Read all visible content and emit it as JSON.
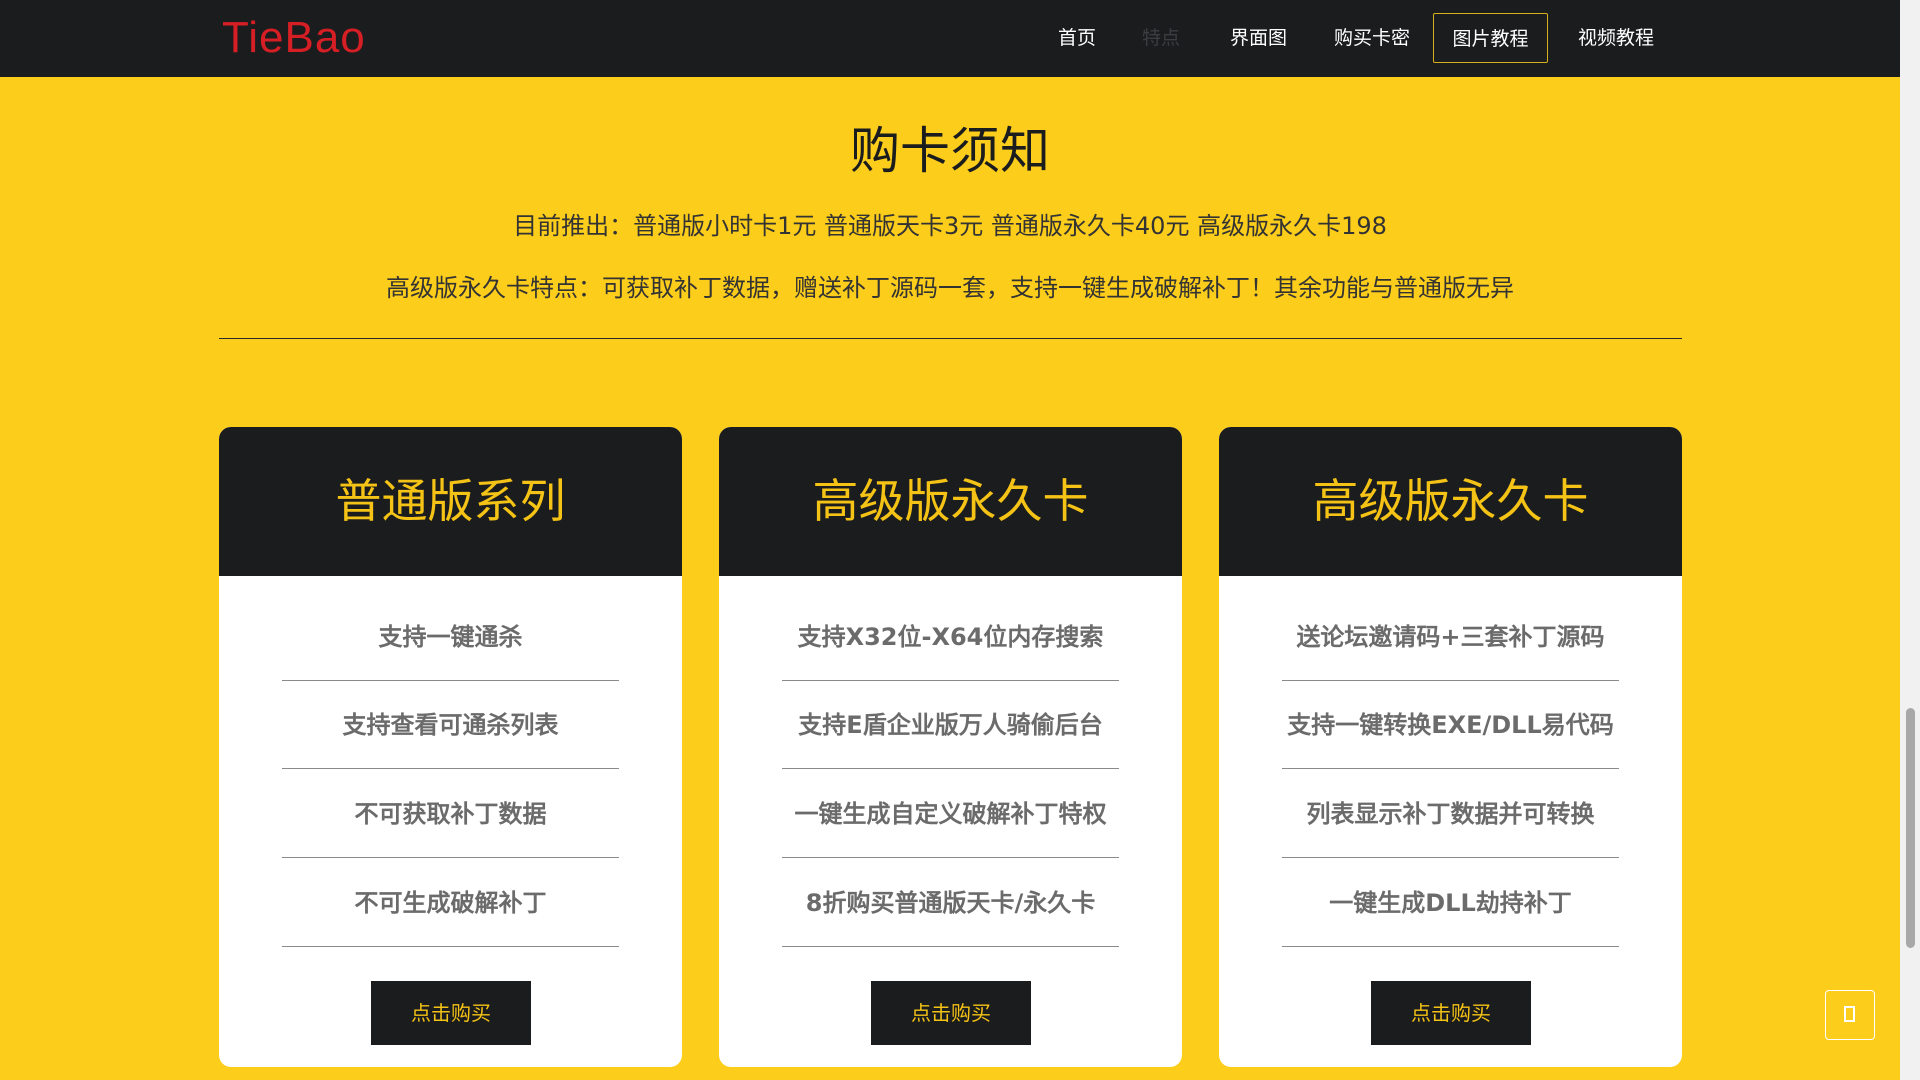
{
  "nav": {
    "logo": "TieBao",
    "items": [
      {
        "label": "首页"
      },
      {
        "label": "特点"
      },
      {
        "label": "界面图"
      },
      {
        "label": "购买卡密"
      },
      {
        "label": "图片教程"
      },
      {
        "label": "视频教程"
      }
    ],
    "active_item": "图片教程"
  },
  "notice": {
    "title": "购卡须知",
    "line1": "目前推出：普通版小时卡1元 普通版天卡3元 普通版永久卡40元 高级版永久卡198",
    "line2": "高级版永久卡特点：可获取补丁数据，赠送补丁源码一套，支持一键生成破解补丁！其余功能与普通版无异"
  },
  "cards": [
    {
      "title": "普通版系列",
      "features": [
        "支持一键通杀",
        "支持查看可通杀列表",
        "不可获取补丁数据",
        "不可生成破解补丁"
      ],
      "button": "点击购买"
    },
    {
      "title": "高级版永久卡",
      "features": [
        "支持X32位-X64位内存搜索",
        "支持E盾企业版万人骑偷后台",
        "一键生成自定义破解补丁特权",
        "8折购买普通版天卡/永久卡"
      ],
      "button": "点击购买"
    },
    {
      "title": "高级版永久卡",
      "features": [
        "送论坛邀请码+三套补丁源码",
        "支持一键转换EXE/DLL易代码",
        "列表显示补丁数据并可转换",
        "一键生成DLL劫持补丁"
      ],
      "button": "点击购买"
    }
  ],
  "colors": {
    "background": "#fccd1b",
    "navbar": "#1b1c1e",
    "logo": "#d61e25",
    "card_title": "#f5c315"
  },
  "icons": {
    "back_to_top": "back-to-top-icon"
  }
}
